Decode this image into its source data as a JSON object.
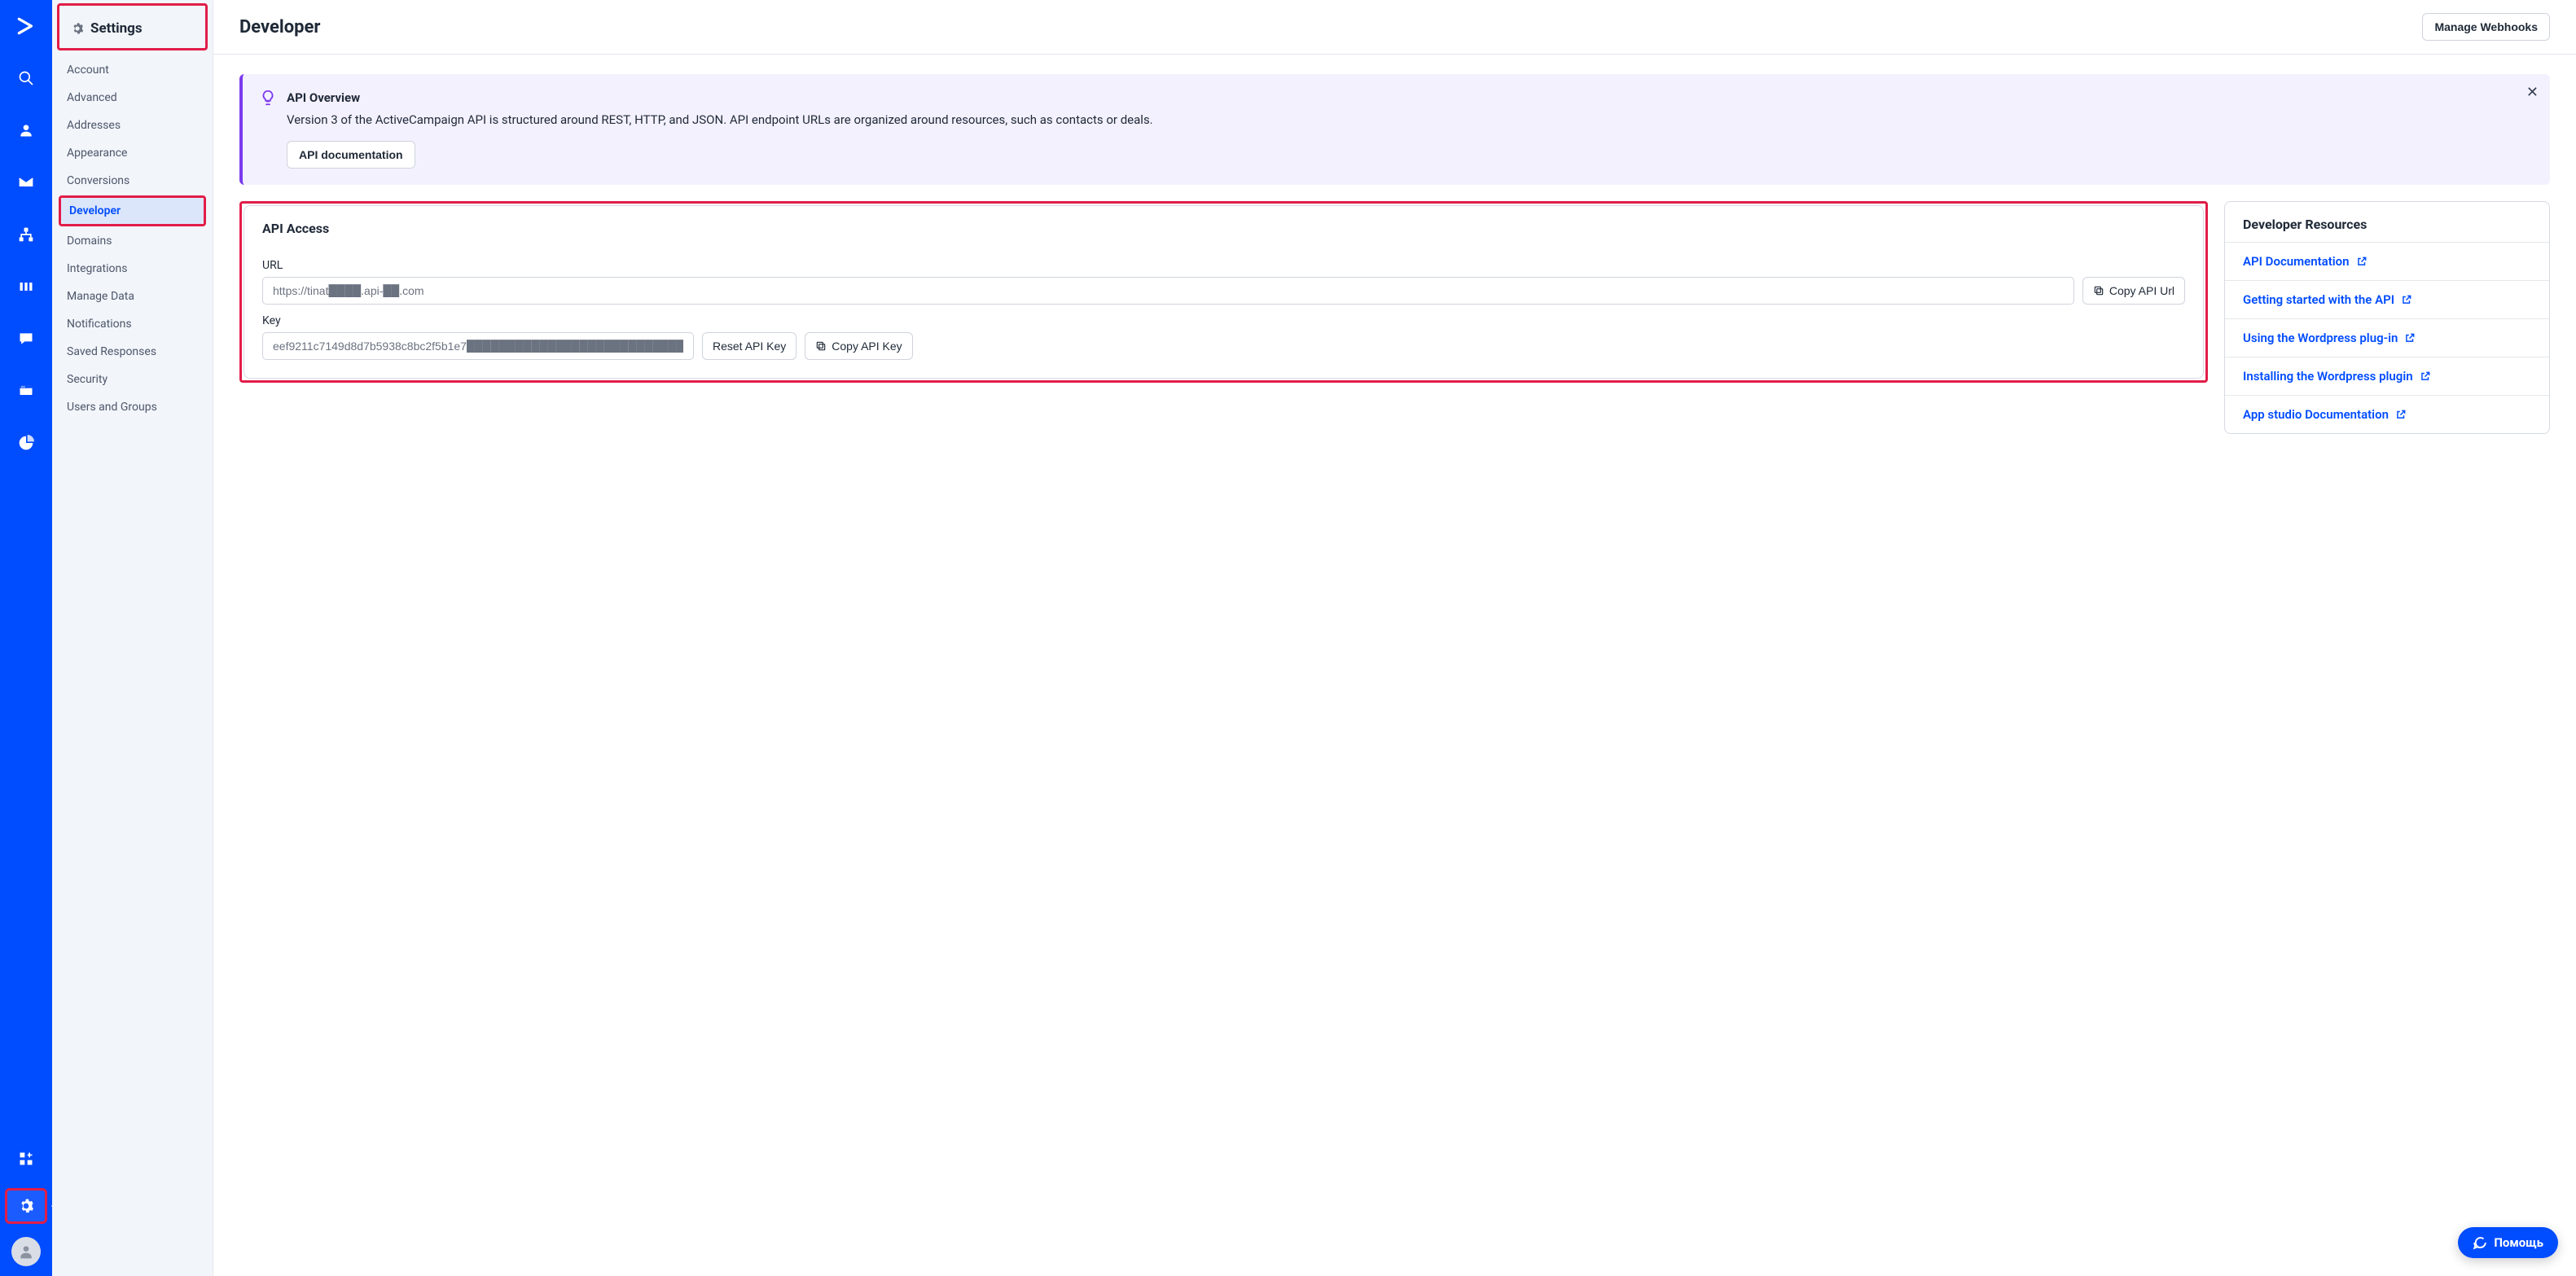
{
  "sidebar": {
    "settings_title": "Settings",
    "items": [
      {
        "label": "Account"
      },
      {
        "label": "Advanced"
      },
      {
        "label": "Addresses"
      },
      {
        "label": "Appearance"
      },
      {
        "label": "Conversions"
      },
      {
        "label": "Developer"
      },
      {
        "label": "Domains"
      },
      {
        "label": "Integrations"
      },
      {
        "label": "Manage Data"
      },
      {
        "label": "Notifications"
      },
      {
        "label": "Saved Responses"
      },
      {
        "label": "Security"
      },
      {
        "label": "Users and Groups"
      }
    ]
  },
  "header": {
    "title": "Developer",
    "manage_webhooks": "Manage Webhooks"
  },
  "banner": {
    "title": "API Overview",
    "desc": "Version 3 of the ActiveCampaign API is structured around REST, HTTP, and JSON. API endpoint URLs are organized around resources, such as contacts or deals.",
    "doc_button": "API documentation"
  },
  "api_access": {
    "title": "API Access",
    "url_label": "URL",
    "url_value": "https://tinat████.api-██.com",
    "copy_url": "Copy API Url",
    "key_label": "Key",
    "key_value": "eef9211c7149d8d7b5938c8bc2f5b1e7████████████████████████████████████",
    "reset_key": "Reset API Key",
    "copy_key": "Copy API Key"
  },
  "resources": {
    "title": "Developer Resources",
    "links": [
      {
        "label": "API Documentation"
      },
      {
        "label": "Getting started with the API"
      },
      {
        "label": "Using the Wordpress plug-in"
      },
      {
        "label": "Installing the Wordpress plugin"
      },
      {
        "label": "App studio Documentation"
      }
    ]
  },
  "help": {
    "label": "Помощь"
  }
}
